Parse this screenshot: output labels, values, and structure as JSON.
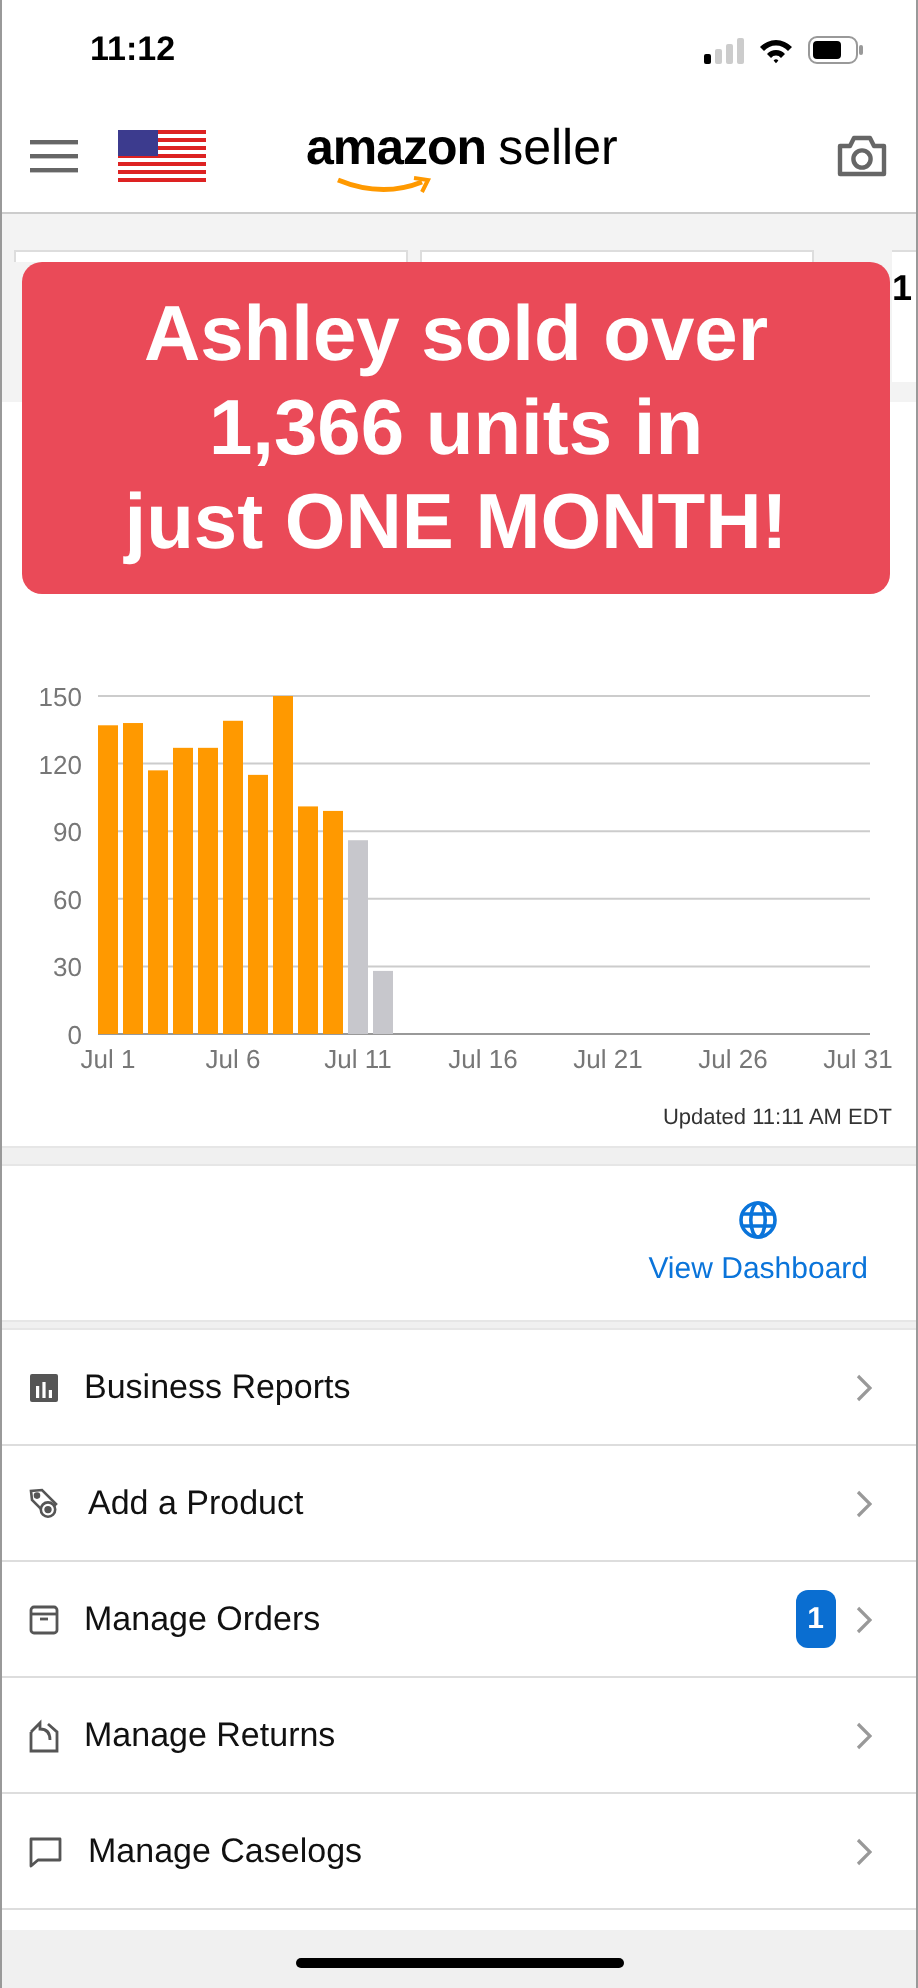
{
  "status_bar": {
    "time": "11:12"
  },
  "header": {
    "logo_brand": "amazon",
    "logo_product": "seller"
  },
  "summary_card_value": "1",
  "banner": {
    "lines": [
      "Ashley sold over",
      "1,366 units in",
      "just ONE MONTH!"
    ]
  },
  "sales_chart": {
    "chart_data": {
      "type": "bar",
      "categories": [
        "Jul 1",
        null,
        null,
        null,
        null,
        "Jul 6",
        null,
        null,
        null,
        null,
        "Jul 11",
        null,
        null,
        null,
        null,
        "Jul 16",
        null,
        null,
        null,
        null,
        "Jul 21",
        null,
        null,
        null,
        null,
        "Jul 26",
        null,
        null,
        null,
        null,
        "Jul 31"
      ],
      "series": [
        {
          "color": "#ff9900",
          "values": [
            137,
            138,
            117,
            127,
            127,
            139,
            115,
            150,
            101,
            99,
            null,
            null,
            null,
            null,
            null,
            null,
            null,
            null,
            null,
            null,
            null,
            null,
            null,
            null,
            null,
            null,
            null,
            null,
            null,
            null,
            null
          ]
        },
        {
          "color": "#c7c7cc",
          "values": [
            null,
            null,
            null,
            null,
            null,
            null,
            null,
            null,
            null,
            null,
            86,
            28,
            null,
            null,
            null,
            null,
            null,
            null,
            null,
            null,
            null,
            null,
            null,
            null,
            null,
            null,
            null,
            null,
            null,
            null,
            null
          ]
        }
      ],
      "ylim": [
        0,
        150
      ],
      "yticks": [
        0,
        30,
        60,
        90,
        120,
        150
      ],
      "grid": true
    },
    "updated": "Updated 11:11 AM EDT"
  },
  "dashboard_link": "View Dashboard",
  "menu": [
    {
      "kind": "reports",
      "label": "Business Reports"
    },
    {
      "kind": "product",
      "label": "Add a Product"
    },
    {
      "kind": "orders",
      "label": "Manage Orders",
      "badge": "1"
    },
    {
      "kind": "returns",
      "label": "Manage Returns"
    },
    {
      "kind": "caselogs",
      "label": "Manage Caselogs"
    }
  ]
}
